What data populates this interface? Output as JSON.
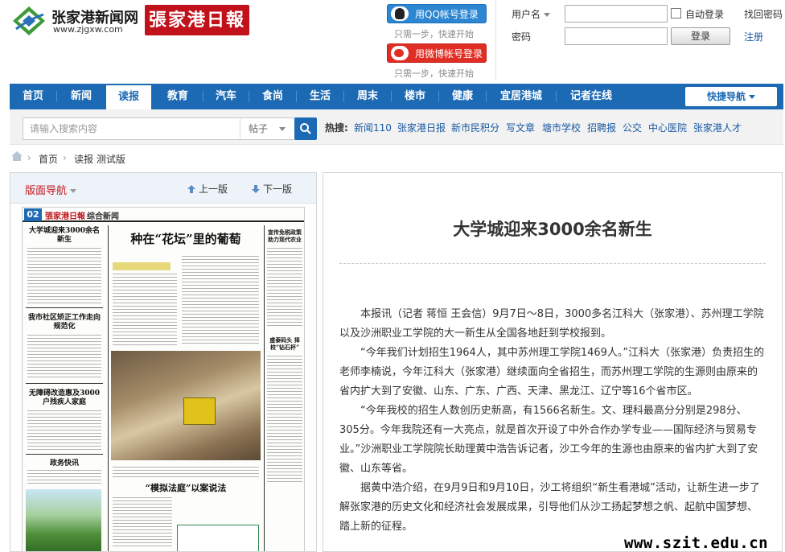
{
  "site": {
    "name": "张家港新闻网",
    "url": "www.zjgxw.com",
    "paper_logo": "張家港日報"
  },
  "social_login": {
    "qq_label": "用QQ帐号登录",
    "qq_hint": "只需一步，快速开始",
    "weibo_label": "用微博帐号登录",
    "weibo_hint": "只需一步，快速开始"
  },
  "login": {
    "username_label": "用户名",
    "password_label": "密码",
    "auto_login_label": "自动登录",
    "forgot_label": "找回密码",
    "login_button": "登录",
    "register_label": "注册"
  },
  "nav": {
    "items": [
      {
        "label": "首页"
      },
      {
        "label": "新闻"
      },
      {
        "label": "读报"
      },
      {
        "label": "教育"
      },
      {
        "label": "汽车"
      },
      {
        "label": "食尚"
      },
      {
        "label": "生活"
      },
      {
        "label": "周末"
      },
      {
        "label": "楼市"
      },
      {
        "label": "健康"
      },
      {
        "label": "宜居港城"
      },
      {
        "label": "记者在线"
      }
    ],
    "active": "读报",
    "quick_nav": "快捷导航"
  },
  "search": {
    "placeholder": "请输入搜索内容",
    "type_selected": "帖子",
    "hot_label": "热搜:",
    "hot_links": [
      "新闻110",
      "张家港日报",
      "新市民积分",
      "写文章",
      "塘市学校",
      "招聘报",
      "公交",
      "中心医院",
      "张家港人才"
    ]
  },
  "breadcrumb": {
    "items": [
      "首页",
      "读报 测试版"
    ]
  },
  "paper_nav": {
    "title": "版面导航",
    "prev": "上一版",
    "next": "下一版"
  },
  "newspaper_page": {
    "page_no": "02",
    "masthead": "張家港日報",
    "section": "综合新闻",
    "headlines": {
      "main": "种在“花坛”里的葡萄",
      "left1": "大学城迎来3000余名新生",
      "left2": "我市社区矫正工作走向规范化",
      "left3": "无障碍改造惠及3000户残疾人家庭",
      "left4": "政务快讯",
      "bottom": "“模拟法庭”以案说法",
      "right1": "宣传免税政策助力现代农业",
      "right2": "盛泰码头 择校“钻石杯”"
    }
  },
  "article": {
    "title": "大学城迎来3000余名新生",
    "paragraphs": [
      "本报讯（记者  蒋恒  王会信）9月7日～8日，3000多名江科大（张家港）、苏州理工学院以及沙洲职业工学院的大一新生从全国各地赶到学校报到。",
      "“今年我们计划招生1964人，其中苏州理工学院1469人。”江科大（张家港）负责招生的老师李楠说，今年江科大（张家港）继续面向全省招生，而苏州理工学院的生源则由原来的省内扩大到了安徽、山东、广东、广西、天津、黑龙江、辽宁等16个省市区。",
      "“今年我校的招生人数创历史新高，有1566名新生。文、理科最高分分别是298分、305分。今年我院还有一大亮点，就是首次开设了中外合作办学专业——国际经济与贸易专业。”沙洲职业工学院院长助理黄中浩告诉记者，沙工今年的生源也由原来的省内扩大到了安徽、山东等省。",
      "据黄中浩介绍，在9月9日和9月10日，沙工将组织“新生看港城”活动，让新生进一步了解张家港的历史文化和经济社会发展成果，引导他们从沙工扬起梦想之帆、起航中国梦想、踏上新的征程。"
    ]
  },
  "watermark": "www.szit.edu.cn",
  "colors": {
    "brand_blue": "#1c6ab4",
    "paper_red": "#c1121c",
    "qq_blue": "#2c86d2",
    "weibo_red": "#e02e24"
  }
}
